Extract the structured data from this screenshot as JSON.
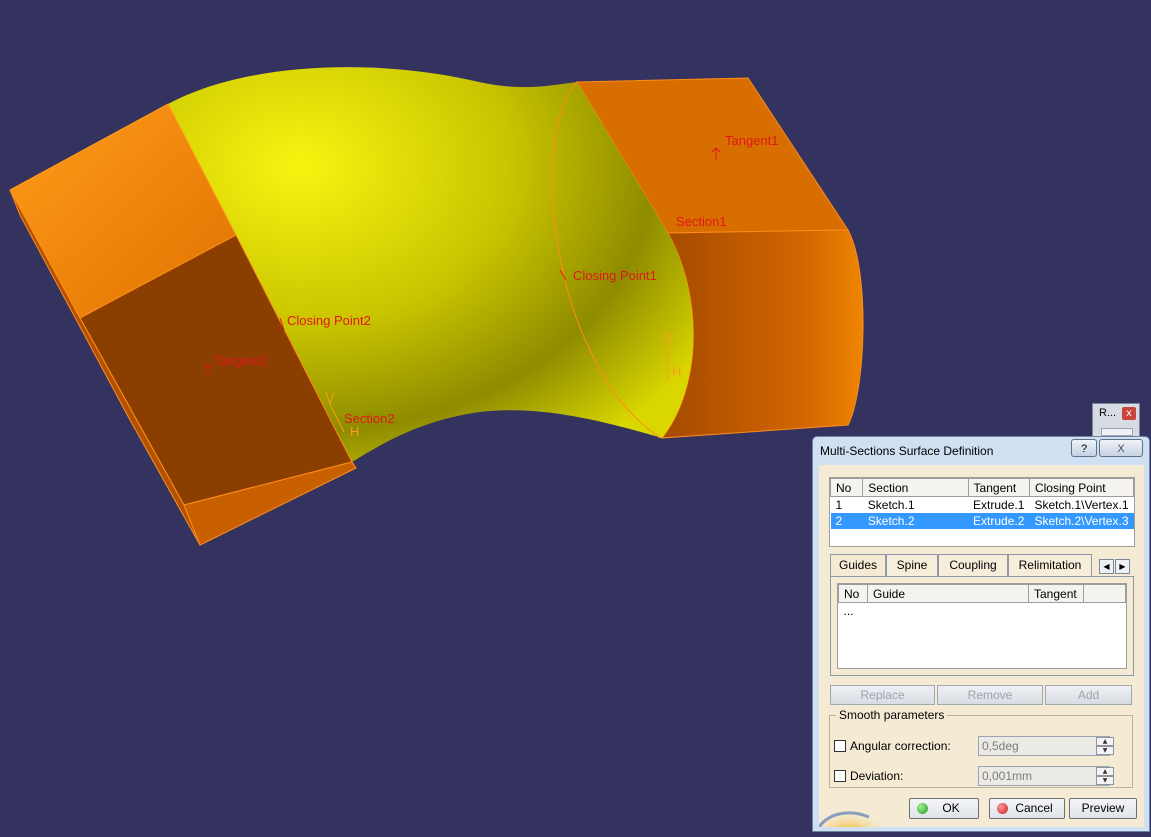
{
  "viewport": {
    "background": "#34335f",
    "annotations": {
      "tangent1": "Tangent1",
      "section1": "Section1",
      "closing_point1": "Closing Point1",
      "closing_point2": "Closing Point2",
      "tangent2": "Tangent2",
      "section2": "Section2",
      "h1": "H",
      "h2": "H"
    },
    "mini_toolbar": {
      "title": "R...",
      "close": "x"
    }
  },
  "dialog": {
    "title": "Multi-Sections Surface Definition",
    "help": "?",
    "close": "X",
    "sections": {
      "columns": [
        "No",
        "Section",
        "Tangent",
        "Closing Point"
      ],
      "rows": [
        [
          "1",
          "Sketch.1",
          "Extrude.1",
          "Sketch.1\\Vertex.1"
        ],
        [
          "2",
          "Sketch.2",
          "Extrude.2",
          "Sketch.2\\Vertex.3"
        ]
      ],
      "selected_row": 2
    },
    "tabs": [
      "Guides",
      "Spine",
      "Coupling",
      "Relimitation"
    ],
    "active_tab": "Guides",
    "guides": {
      "columns": [
        "No",
        "Guide",
        "Tangent"
      ],
      "placeholder": "..."
    },
    "buttons": {
      "replace": "Replace",
      "remove": "Remove",
      "add": "Add"
    },
    "smooth": {
      "legend": "Smooth parameters",
      "angular_label": "Angular correction:",
      "angular_value": "0,5deg",
      "deviation_label": "Deviation:",
      "deviation_value": "0,001mm"
    },
    "footer": {
      "ok": "OK",
      "cancel": "Cancel",
      "preview": "Preview"
    }
  }
}
